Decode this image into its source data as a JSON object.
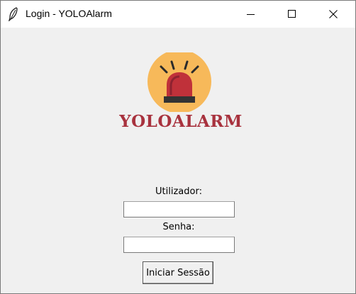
{
  "window": {
    "title": "Login - YOLOAlarm",
    "controls": {
      "minimize": "minimize-icon",
      "maximize": "maximize-icon",
      "close": "close-icon"
    },
    "app_icon": "feather-icon"
  },
  "logo": {
    "text": "YOLOALARM",
    "icon": "siren-icon",
    "colors": {
      "circle": "#f7b95a",
      "siren": "#c0313a",
      "base": "#333333",
      "text": "#a8323e"
    }
  },
  "form": {
    "username_label": "Utilizador:",
    "username_value": "",
    "password_label": "Senha:",
    "password_value": "",
    "submit_label": "Iniciar Sessão"
  }
}
